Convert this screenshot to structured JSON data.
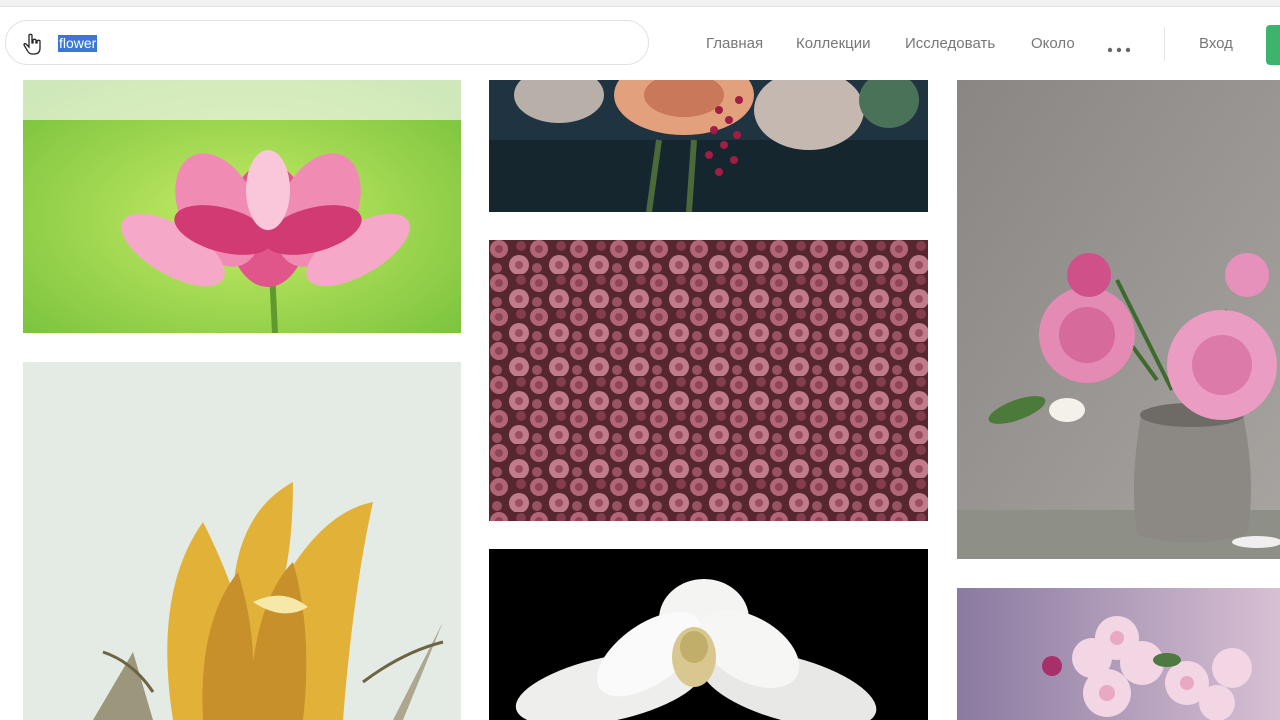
{
  "search": {
    "value": "flower",
    "icon": "pointer-hand-icon"
  },
  "nav": {
    "items": [
      {
        "label": "Главная"
      },
      {
        "label": "Коллекции"
      },
      {
        "label": "Исследовать"
      },
      {
        "label": "Около"
      }
    ],
    "more_icon": "ellipsis-icon",
    "login_label": "Вход"
  },
  "colors": {
    "selection": "#3a78d8",
    "accent": "#3cb46e",
    "nav_text": "#777777"
  },
  "gallery": {
    "photos": [
      {
        "subject": "pink lotus"
      },
      {
        "subject": "bouquet with roses"
      },
      {
        "subject": "pink chrysanthemums"
      },
      {
        "subject": "peonies in grey vase"
      },
      {
        "subject": "yellow flower bud"
      },
      {
        "subject": "white magnolia"
      },
      {
        "subject": "pink blossoms"
      }
    ]
  }
}
